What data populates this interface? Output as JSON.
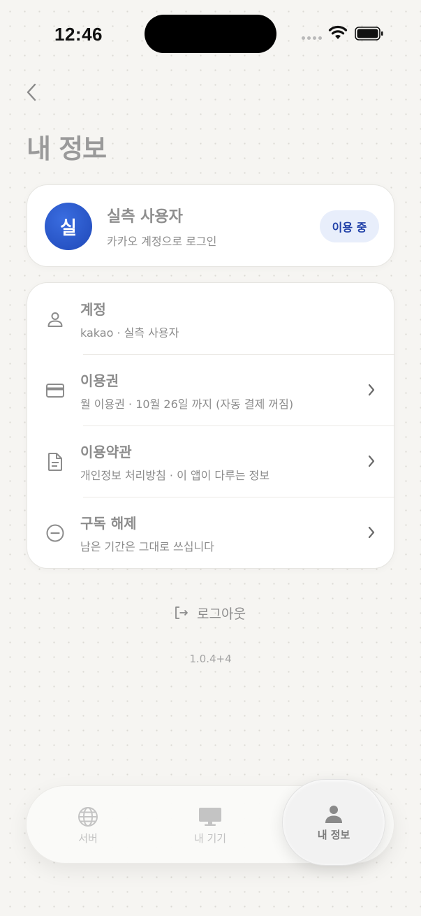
{
  "status_bar": {
    "time": "12:46"
  },
  "header": {
    "title": "내 정보"
  },
  "profile": {
    "avatar_initial": "실",
    "name": "실측 사용자",
    "subtitle": "카카오 계정으로 로그인",
    "status_badge": "이용 중"
  },
  "menu": {
    "items": [
      {
        "title": "계정",
        "subtitle": "kakao · 실측 사용자",
        "icon": "person-icon",
        "has_chevron": false
      },
      {
        "title": "이용권",
        "subtitle": "월 이용권 · 10월 26일 까지 (자동 결제 꺼짐)",
        "icon": "credit-card-icon",
        "has_chevron": true
      },
      {
        "title": "이용약관",
        "subtitle": "개인정보 처리방침 · 이 앱이 다루는 정보",
        "icon": "document-icon",
        "has_chevron": true
      },
      {
        "title": "구독 해제",
        "subtitle": "남은 기간은 그대로 쓰십니다",
        "icon": "minus-circle-icon",
        "has_chevron": true
      }
    ]
  },
  "logout": {
    "label": "로그아웃",
    "icon": "logout-icon"
  },
  "version": "1.0.4+4",
  "tab_bar": {
    "tabs": [
      {
        "label": "서버",
        "icon": "globe-icon"
      },
      {
        "label": "내 기기",
        "icon": "monitor-icon"
      },
      {
        "label": "내 정보",
        "icon": "person-icon"
      }
    ],
    "active": "내 정보"
  },
  "colors": {
    "background": "#f6f5f2",
    "accent": "#2447b8",
    "badge_bg": "#e8eefb",
    "text_muted": "#8c8c8c"
  }
}
